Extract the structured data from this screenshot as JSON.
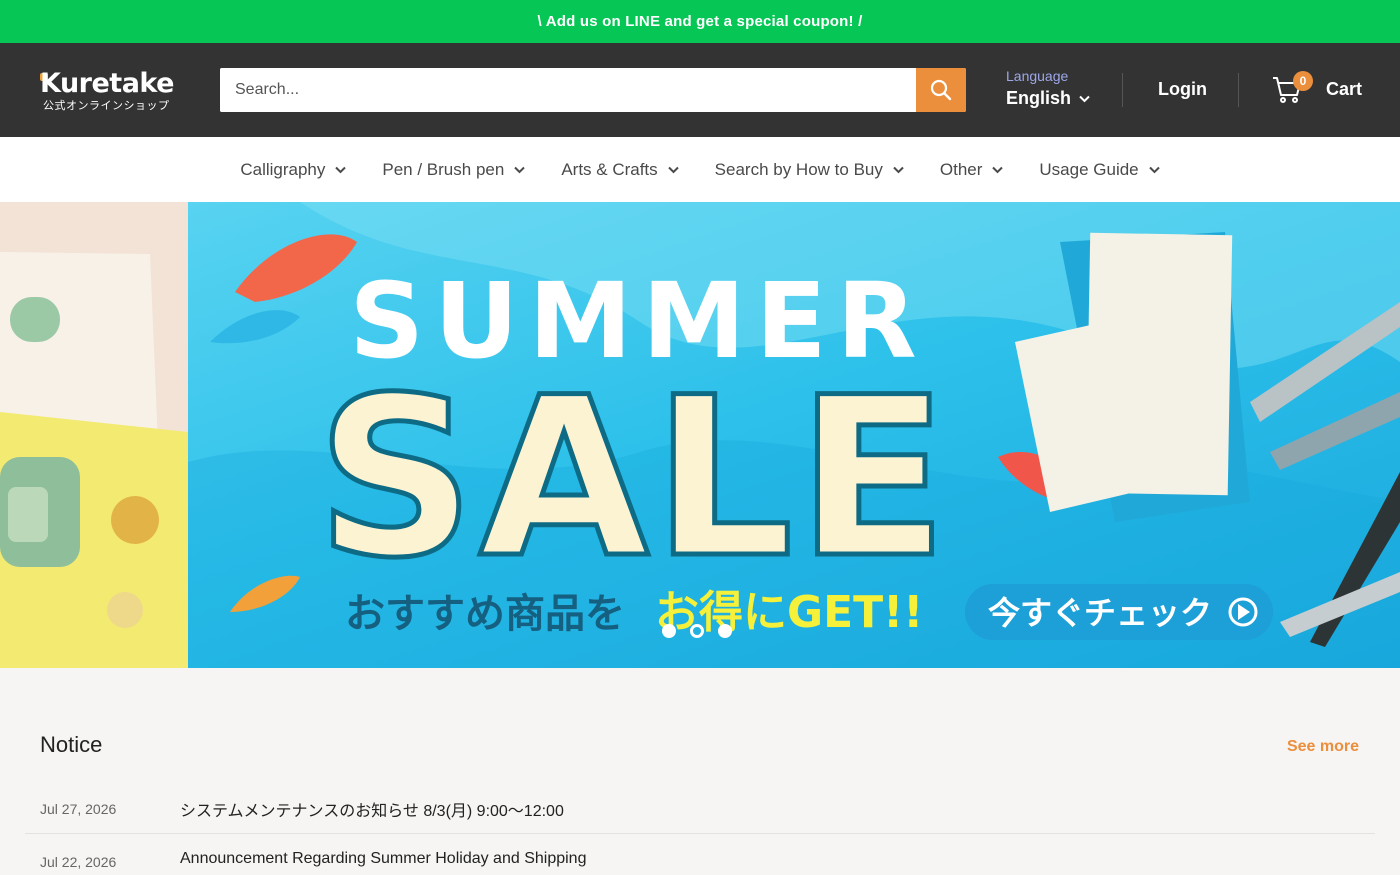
{
  "announcement": {
    "text": "\\  Add us on LINE and get a special coupon!  /"
  },
  "brand": {
    "logo_text": "Kuretake",
    "logo_subtext": "公式オンラインショップ",
    "accent_color": "#ec8f3d",
    "line_green": "#06c755"
  },
  "search": {
    "placeholder": "Search...",
    "icon": "search-icon"
  },
  "language": {
    "caption": "Language",
    "value": "English"
  },
  "account": {
    "login_label": "Login"
  },
  "cart": {
    "count": "0",
    "label": "Cart"
  },
  "nav": {
    "items": [
      {
        "label": "Calligraphy"
      },
      {
        "label": "Pen / Brush pen"
      },
      {
        "label": "Arts & Crafts"
      },
      {
        "label": "Search by How to Buy"
      },
      {
        "label": "Other"
      },
      {
        "label": "Usage Guide"
      }
    ]
  },
  "hero": {
    "line1": "SUMMER",
    "line2": "SALE",
    "tagline_a": "おすすめ商品を",
    "tagline_b": "お得にGET!!",
    "cta": "今すぐチェック",
    "slides": 3,
    "active_slide": 2
  },
  "notice": {
    "title": "Notice",
    "see_more": "See more",
    "items": [
      {
        "date": "Jul 27, 2026",
        "text": "システムメンテナンスのお知らせ 8/3(月) 9:00～12:00"
      },
      {
        "date": "Jul 22, 2026",
        "text": "Announcement Regarding Summer Holiday and Shipping"
      }
    ]
  }
}
